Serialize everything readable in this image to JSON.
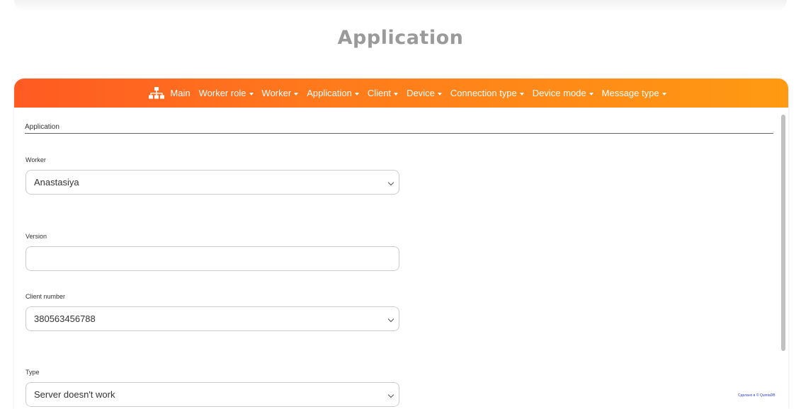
{
  "page": {
    "title": "Application"
  },
  "nav": {
    "main": "Main",
    "items": [
      "Worker role",
      "Worker",
      "Application",
      "Client",
      "Device",
      "Connection type",
      "Device mode",
      "Message type"
    ]
  },
  "form": {
    "section": "Application",
    "worker": {
      "label": "Worker",
      "value": "Anastasiya"
    },
    "version": {
      "label": "Version",
      "value": ""
    },
    "client_number": {
      "label": "Client number",
      "value": "380563456788"
    },
    "type": {
      "label": "Type",
      "value": "Server doesn't work"
    }
  },
  "footer": {
    "watermark": "Сделано в © QuintaDB"
  },
  "colors": {
    "nav_start": "#ff5a22",
    "nav_end": "#ff9a12",
    "title": "#9a9a9a"
  },
  "icons": {
    "main": "sitemap-icon",
    "dropdown": "chevron-down-icon",
    "menu_caret": "caret-down-icon"
  }
}
